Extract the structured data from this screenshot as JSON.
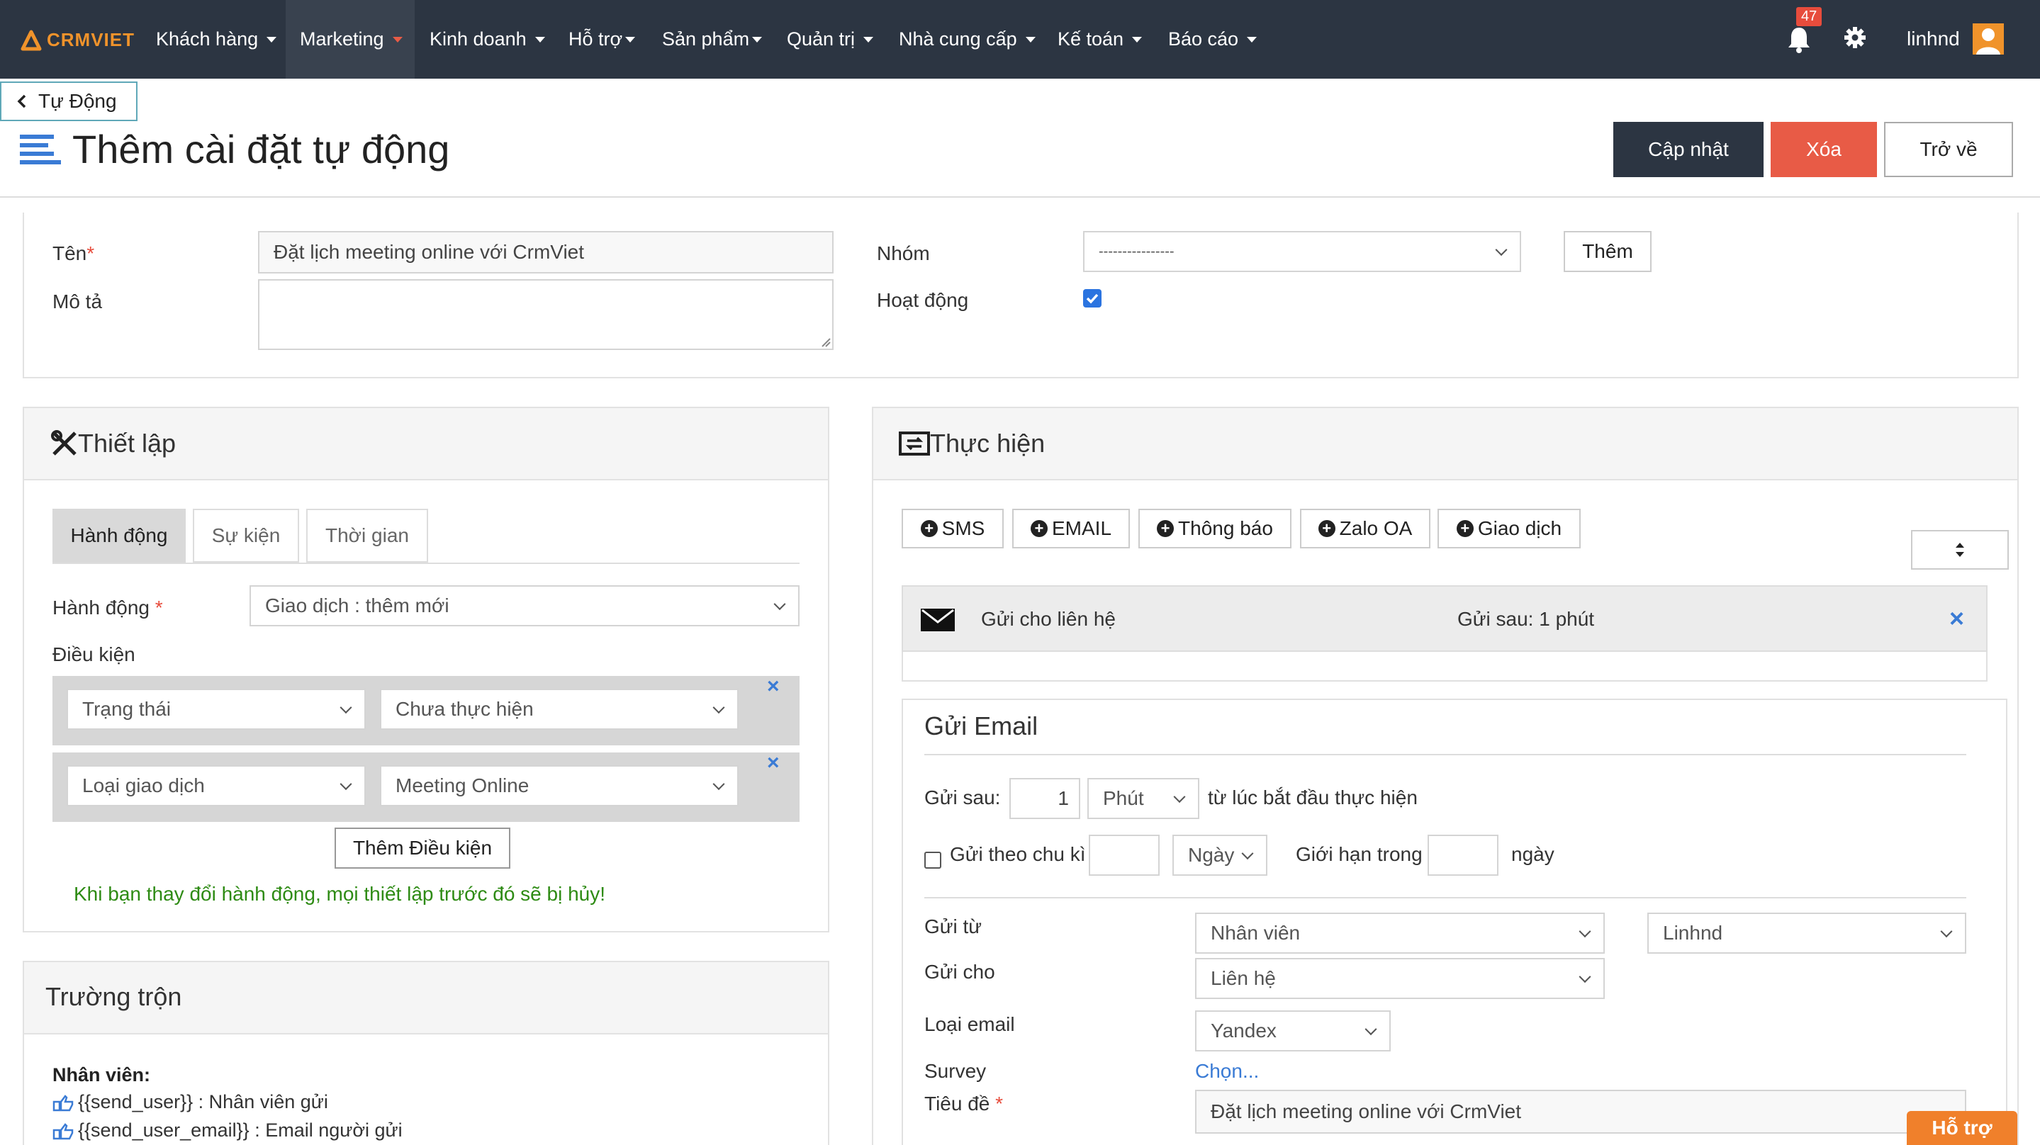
{
  "app": {
    "logo_text": "CRMVIET",
    "nav_items": [
      {
        "label": "Khách hàng"
      },
      {
        "label": "Marketing"
      },
      {
        "label": "Kinh doanh"
      },
      {
        "label": "Hỗ trợ"
      },
      {
        "label": "Sản phẩm"
      },
      {
        "label": "Quản trị"
      },
      {
        "label": "Nhà cung cấp"
      },
      {
        "label": "Kế toán"
      },
      {
        "label": "Báo cáo"
      }
    ],
    "active_nav": "Marketing",
    "notification_count": "47",
    "username": "linhnd"
  },
  "page": {
    "back_label": "Tự Động",
    "title": "Thêm cài đặt tự động",
    "buttons": {
      "update": "Cập nhật",
      "delete": "Xóa",
      "back": "Trở về"
    }
  },
  "form": {
    "name_label": "Tên",
    "name_value": "Đặt lịch meeting online với CrmViet",
    "desc_label": "Mô tả",
    "desc_value": "",
    "group_label": "Nhóm",
    "group_value": "----------------",
    "add_button": "Thêm",
    "active_label": "Hoạt động",
    "active_checked": true
  },
  "setup": {
    "title": "Thiết lập",
    "tabs": [
      "Hành động",
      "Sự kiện",
      "Thời gian"
    ],
    "action_label": "Hành động",
    "action_value": "Giao dịch : thêm mới",
    "conditions_label": "Điều kiện",
    "conditions": [
      {
        "field": "Trạng thái",
        "value": "Chưa thực hiện"
      },
      {
        "field": "Loại giao dịch",
        "value": "Meeting Online"
      }
    ],
    "add_condition": "Thêm Điều kiện",
    "warning": "Khi bạn thay đổi hành động, mọi thiết lập trước đó sẽ bị hủy!"
  },
  "merge": {
    "title": "Trường trộn",
    "section": "Nhân viên:",
    "items": [
      "{{send_user}} : Nhân viên gửi",
      "{{send_user_email}} : Email người gửi"
    ]
  },
  "execute": {
    "title": "Thực hiện",
    "buttons": [
      "SMS",
      "EMAIL",
      "Thông báo",
      "Zalo OA",
      "Giao dịch"
    ],
    "item": {
      "label": "Gửi cho liên hệ",
      "delay": "Gửi sau: 1 phút"
    }
  },
  "email": {
    "title": "Gửi Email",
    "send_after_label": "Gửi sau:",
    "send_after_value": "1",
    "unit": "Phút",
    "from_start": "từ lúc bắt đầu thực hiện",
    "periodic_label": "Gửi theo chu kì",
    "periodic_unit": "Ngày",
    "limit_label": "Giới hạn trong",
    "limit_unit": "ngày",
    "from_label": "Gửi từ",
    "from_value": "Nhân viên",
    "from_user": "Linhnd",
    "to_label": "Gửi cho",
    "to_value": "Liên hệ",
    "type_label": "Loại email",
    "type_value": "Yandex",
    "survey_label": "Survey",
    "survey_link": "Chọn...",
    "subject_label": "Tiêu đề",
    "subject_value": "Đặt lịch meeting online với CrmViet"
  },
  "support_label": "Hỗ trợ"
}
